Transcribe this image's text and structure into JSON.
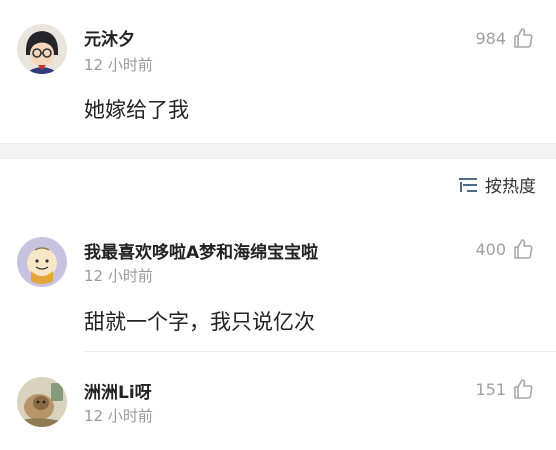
{
  "comments": [
    {
      "username": "元沐夕",
      "time": "12 小时前",
      "likes": "984",
      "content": "她嫁给了我"
    },
    {
      "username": "我最喜欢哆啦A梦和海绵宝宝啦",
      "time": "12 小时前",
      "likes": "400",
      "content": "甜就一个字，我只说亿次"
    },
    {
      "username": "洲洲Li呀",
      "time": "12 小时前",
      "likes": "151",
      "content": ""
    }
  ],
  "sort": {
    "label": "按热度"
  },
  "icons": {
    "like": "thumbs-up-icon",
    "sort": "sort-lines-icon"
  },
  "colors": {
    "meta": "#9a9a9a",
    "divider": "#f3f3f3"
  }
}
